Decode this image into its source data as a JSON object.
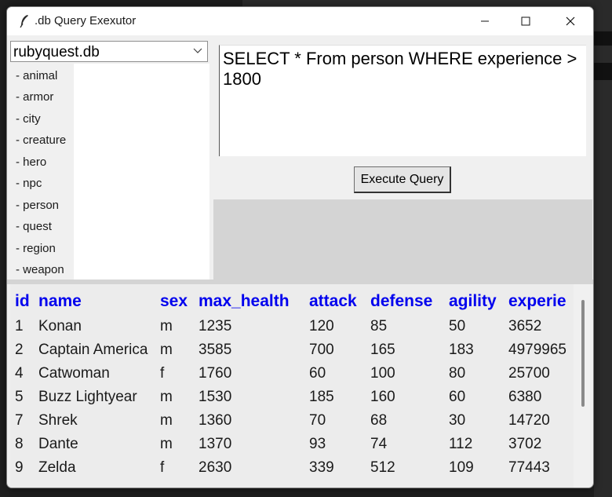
{
  "window": {
    "title": ".db Query Exexutor"
  },
  "database": {
    "selected": "rubyquest.db"
  },
  "tables": [
    "- animal",
    "- armor",
    "- city",
    "- creature",
    "- hero",
    "- npc",
    "- person",
    "- quest",
    "- region",
    "- weapon"
  ],
  "query": {
    "text": "SELECT * From person WHERE experience > 1800",
    "execute_label": "Execute Query"
  },
  "results": {
    "columns": [
      "id",
      "name",
      "sex",
      "max_health",
      "attack",
      "defense",
      "agility",
      "experie"
    ],
    "rows": [
      [
        "1",
        "Konan",
        "m",
        "1235",
        "120",
        "85",
        "50",
        "3652"
      ],
      [
        "2",
        "Captain America",
        "m",
        "3585",
        "700",
        "165",
        "183",
        "4979965"
      ],
      [
        "4",
        "Catwoman",
        "f",
        "1760",
        "60",
        "100",
        "80",
        "25700"
      ],
      [
        "5",
        "Buzz Lightyear",
        "m",
        "1530",
        "185",
        "160",
        "60",
        "6380"
      ],
      [
        "7",
        "Shrek",
        "m",
        "1360",
        "70",
        "68",
        "30",
        "14720"
      ],
      [
        "8",
        "Dante",
        "m",
        "1370",
        "93",
        "74",
        "112",
        "3702"
      ],
      [
        "9",
        "Zelda",
        "f",
        "2630",
        "339",
        "512",
        "109",
        "77443"
      ]
    ]
  },
  "colors": {
    "header_text": "#0000ee",
    "window_bg": "#f0f0f0"
  }
}
